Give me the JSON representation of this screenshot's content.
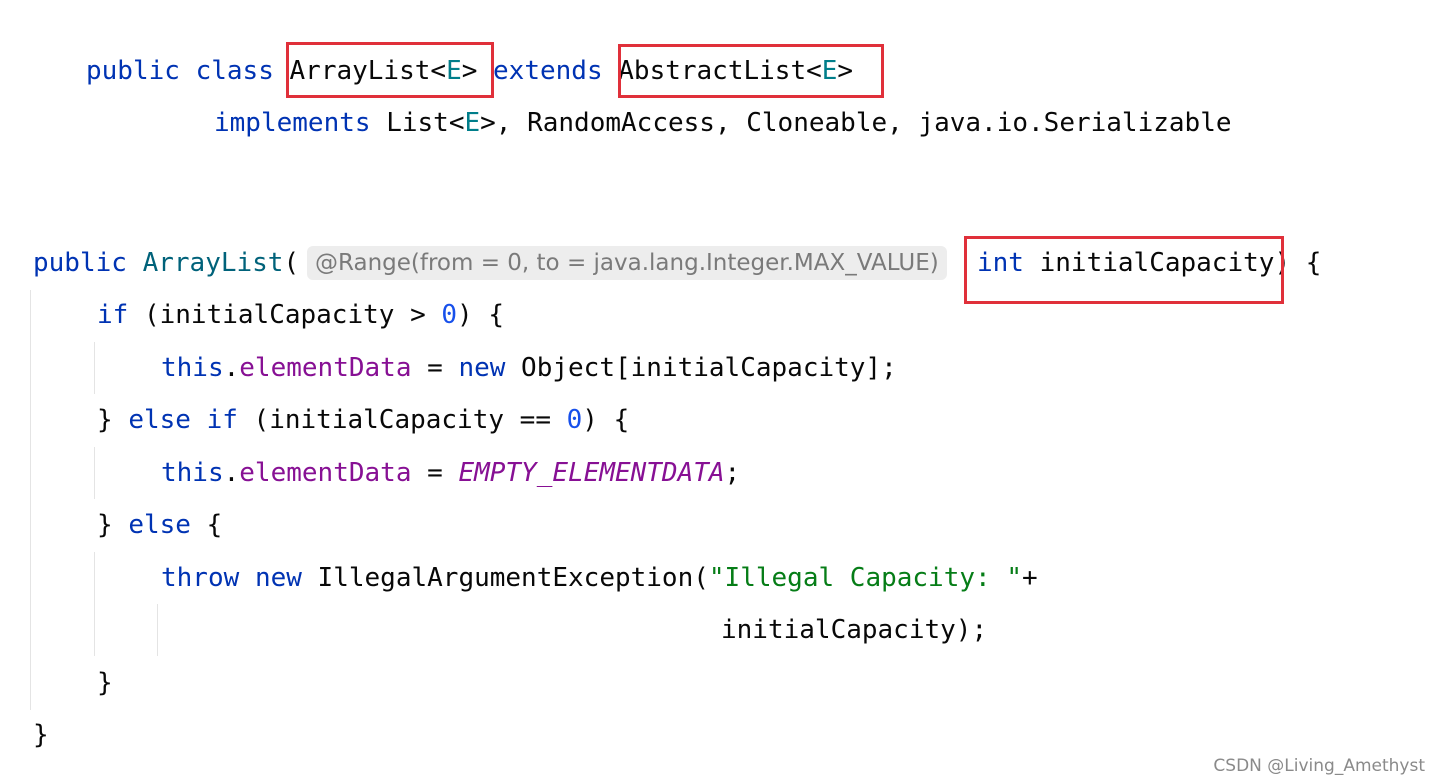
{
  "editor": {
    "class_decl": {
      "kw_public": "public",
      "kw_class": "class",
      "class_name": "ArrayList",
      "lt": "<",
      "type_param": "E",
      "gt": ">",
      "kw_extends": "extends",
      "super_name": "AbstractList",
      "super_lt": "<",
      "super_param": "E",
      "super_gt": ">"
    },
    "implements_line": {
      "kw_implements": "implements",
      "iface1": "List",
      "iface1_lt": "<",
      "iface1_param": "E",
      "rest": ">, RandomAccess, Cloneable, java.io.Serializable"
    },
    "ctor_decl": {
      "kw_public": "public",
      "ctor_name": "ArrayList",
      "open_paren": "(",
      "annotation_hint": "@Range(from = 0, to = java.lang.Integer.MAX_VALUE)",
      "kw_int": "int",
      "param_name": "initialCapacity",
      "close": ") {"
    },
    "if_line": {
      "kw_if": "if",
      "cond_open": " (initialCapacity > ",
      "zero": "0",
      "cond_close": ") {"
    },
    "assign1_line": {
      "kw_this": "this",
      "dot": ".",
      "field": "elementData",
      "eq": " = ",
      "kw_new": "new",
      "expr": " Object[initialCapacity];"
    },
    "elseif_line": {
      "brace": "} ",
      "kw_else": "else",
      "kw_if": "if",
      "cond_open": " (initialCapacity == ",
      "zero": "0",
      "cond_close": ") {"
    },
    "assign2_line": {
      "kw_this": "this",
      "dot": ".",
      "field": "elementData",
      "eq": " = ",
      "constant": "EMPTY_ELEMENTDATA",
      "semi": ";"
    },
    "else_line": {
      "brace": "} ",
      "kw_else": "else",
      "open": " {"
    },
    "throw_line": {
      "kw_throw": "throw",
      "kw_new": "new",
      "exception": " IllegalArgumentException(",
      "message": "\"Illegal Capacity: \"",
      "plus": "+"
    },
    "throw_cont_line": {
      "text": "initialCapacity);"
    },
    "close_if_line": {
      "text": "}"
    },
    "close_method_line": {
      "text": "}"
    }
  },
  "watermark": {
    "text": "CSDN @Living_Amethyst"
  },
  "colors": {
    "keyword": "#0033b3",
    "constructor": "#00627a",
    "type_param": "#007e8a",
    "field": "#871094",
    "number": "#1750eb",
    "string": "#067d17",
    "highlight_box": "#e0303a"
  }
}
